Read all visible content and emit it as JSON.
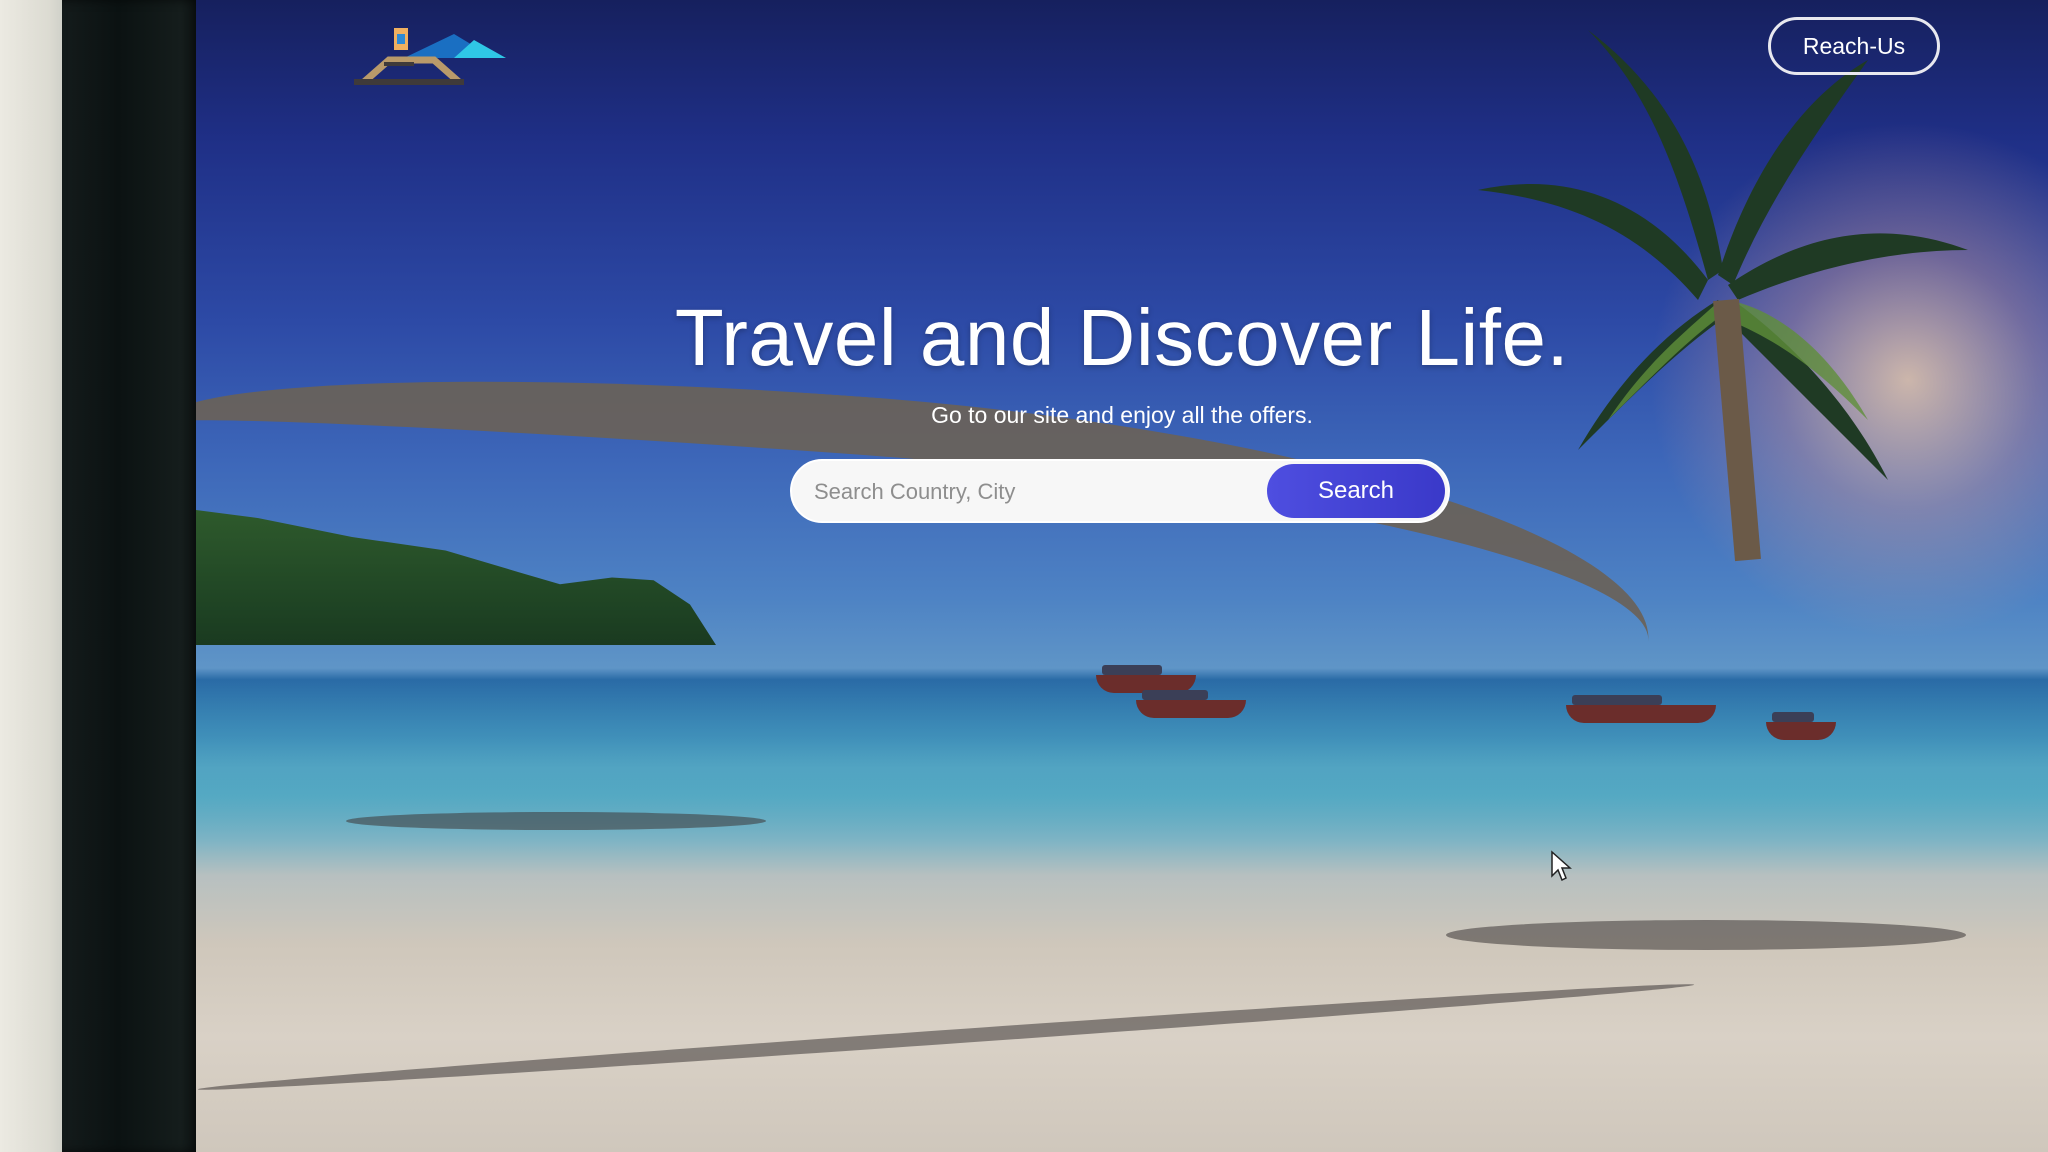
{
  "header": {
    "logo_icon": "camping-tent-logo-icon",
    "reach_us_label": "Reach-Us"
  },
  "hero": {
    "title": "Travel and Discover Life.",
    "subtitle": "Go to our site and enjoy all the offers."
  },
  "search": {
    "placeholder": "Search Country, City",
    "value": "",
    "button_label": "Search"
  },
  "colors": {
    "search_button": "#4545d6",
    "text": "#ffffff"
  }
}
